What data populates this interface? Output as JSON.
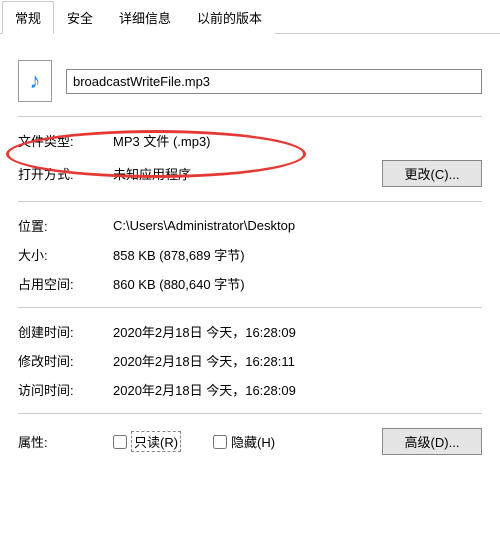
{
  "tabs": {
    "general": "常规",
    "security": "安全",
    "details": "详细信息",
    "previous": "以前的版本"
  },
  "filename": "broadcastWriteFile.mp3",
  "rows": {
    "filetype_label": "文件类型:",
    "filetype_value": "MP3 文件 (.mp3)",
    "openwith_label": "打开方式:",
    "openwith_value": "未知应用程序",
    "change_btn": "更改(C)...",
    "location_label": "位置:",
    "location_value": "C:\\Users\\Administrator\\Desktop",
    "size_label": "大小:",
    "size_value": "858 KB (878,689 字节)",
    "diskspace_label": "占用空间:",
    "diskspace_value": "860 KB (880,640 字节)",
    "created_label": "创建时间:",
    "created_value": "2020年2月18日 今天，16:28:09",
    "modified_label": "修改时间:",
    "modified_value": "2020年2月18日 今天，16:28:11",
    "accessed_label": "访问时间:",
    "accessed_value": "2020年2月18日 今天，16:28:09",
    "attributes_label": "属性:",
    "readonly_label": "只读(R)",
    "hidden_label": "隐藏(H)",
    "advanced_btn": "高级(D)..."
  },
  "icons": {
    "music": "♪"
  }
}
